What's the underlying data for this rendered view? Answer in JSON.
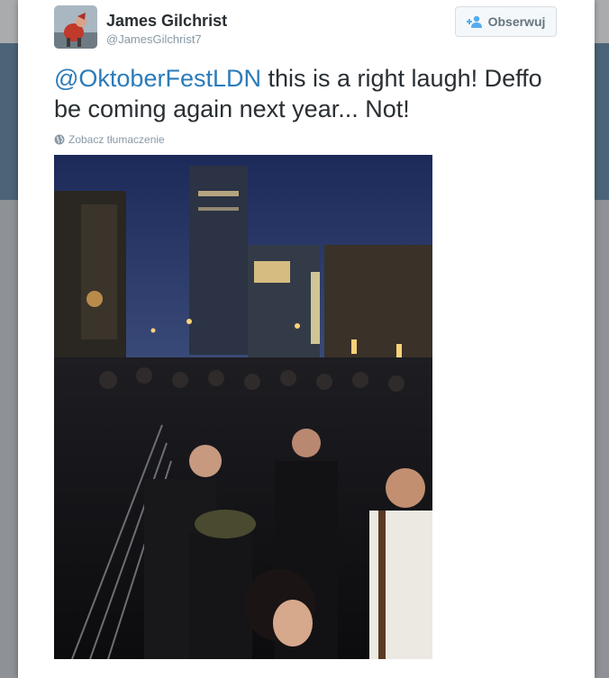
{
  "tweet": {
    "author_name": "James Gilchrist",
    "author_handle": "@JamesGilchrist7",
    "follow_label": "Obserwuj",
    "mention": "@OktoberFestLDN",
    "body": " this is a right laugh! Deffo be coming again next year... Not!",
    "translate_label": "Zobacz tłumaczenie"
  },
  "icons": {
    "follow": "add-user-icon",
    "translate": "globe-icon",
    "avatar": "avatar-image",
    "photo": "crowd-photo"
  },
  "colors": {
    "link": "#2b7bb9",
    "text": "#292f33",
    "muted": "#8899a6"
  }
}
